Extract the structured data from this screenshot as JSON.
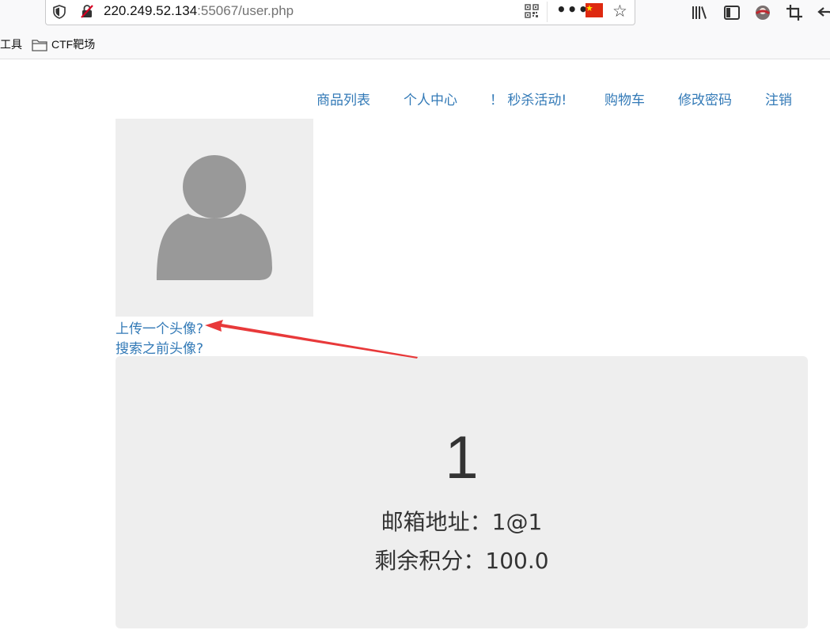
{
  "browser": {
    "url_host": "220.249.52.134",
    "url_rest": ":55067/user.php",
    "more_icon": "more-dots-icon",
    "flag_icon": "china-flag-icon",
    "bookmark_star": "star-icon"
  },
  "bookmarks": {
    "tools_label": "工具",
    "folder_label": "CTF靶场"
  },
  "nav": {
    "items": [
      {
        "label": "商品列表"
      },
      {
        "label": "个人中心"
      },
      {
        "label": "！ 秒杀活动!"
      },
      {
        "label": "购物车"
      },
      {
        "label": "修改密码"
      },
      {
        "label": "注销"
      }
    ]
  },
  "profile": {
    "upload_link": "上传一个头像?",
    "search_link": "搜索之前头像?"
  },
  "account": {
    "username": "1",
    "email_line": "邮箱地址：1@1",
    "points_line": "剩余积分：100.0"
  },
  "colors": {
    "link": "#337ab7",
    "panel_bg": "#eeeeee",
    "annotation_arrow": "#e8393a"
  }
}
